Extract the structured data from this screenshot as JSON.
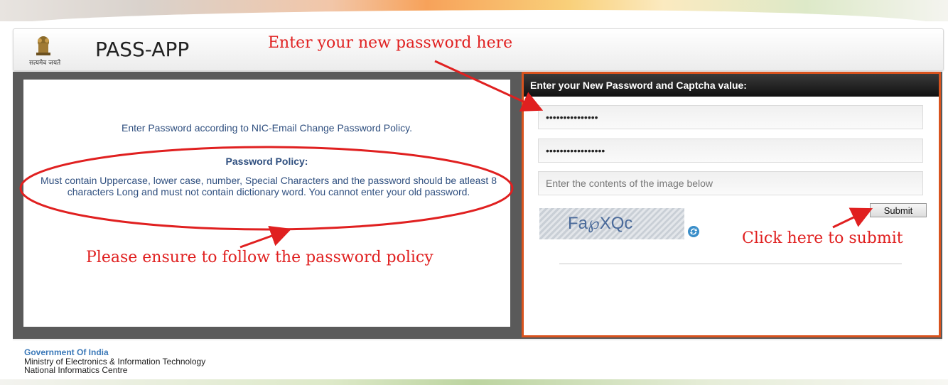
{
  "header": {
    "app_title": "PASS-APP",
    "emblem_caption": "सत्यमेव जयते"
  },
  "annotations": {
    "top": "Enter your new password here",
    "left": "Please ensure to follow the password policy",
    "right": "Click here to submit"
  },
  "policy": {
    "intro": "Enter Password according to NIC-Email Change Password Policy.",
    "title": "Password Policy:",
    "text": "Must contain Uppercase, lower case, number, Special Characters and the password should be atleast 8 characters Long and must not contain dictionary word. You cannot enter your old password."
  },
  "form": {
    "header": "Enter your New Password and Captcha value:",
    "password_value": "•••••••••••••••",
    "confirm_password_value": "•••••••••••••••••",
    "captcha_placeholder": "Enter the contents of the image below",
    "captcha_text": "Fa℘XQc",
    "submit_label": "Submit"
  },
  "footer": {
    "org": "Government Of India",
    "line2": "Ministry of Electronics & Information Technology",
    "line3": "National Informatics Centre"
  },
  "colors": {
    "annotation": "#e02020",
    "panel_border": "#d9531e",
    "text_blue": "#2f4f7f"
  }
}
